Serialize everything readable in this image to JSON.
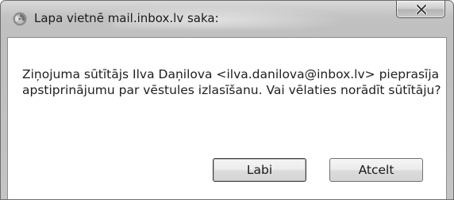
{
  "dialog": {
    "title": "Lapa vietnē mail.inbox.lv saka:",
    "message": "Ziņojuma sūtītājs Ilva Daņilova <ilva.danilova@inbox.lv> pieprasīja apstiprinājumu par vēstules izlasīšanu. Vai vēlaties norādīt sūtītāju?",
    "ok_label": "Labi",
    "cancel_label": "Atcelt",
    "close_icon": "close-icon",
    "app_icon": "browser-icon"
  }
}
